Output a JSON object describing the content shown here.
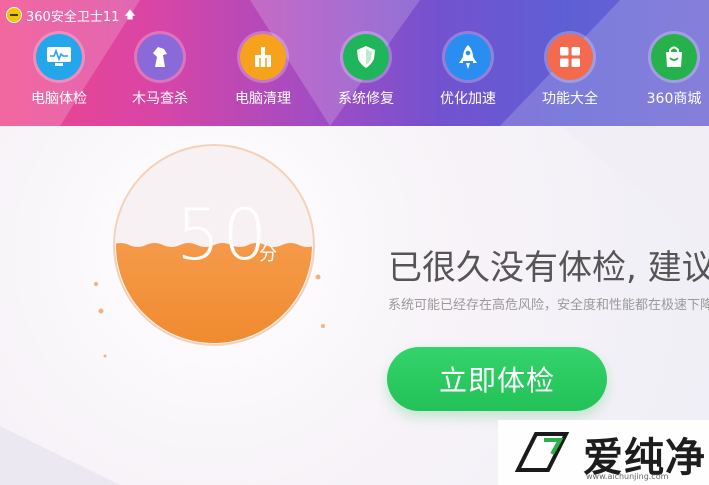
{
  "window": {
    "title": "360安全卫士11"
  },
  "nav": {
    "items": [
      {
        "label": "电脑体检",
        "icon": "monitor-icon",
        "color": "#23a6ea"
      },
      {
        "label": "木马查杀",
        "icon": "horse-icon",
        "color": "#8a6ad8"
      },
      {
        "label": "电脑清理",
        "icon": "broom-icon",
        "color": "#f6a21d"
      },
      {
        "label": "系统修复",
        "icon": "shield-icon",
        "color": "#1fb55a"
      },
      {
        "label": "优化加速",
        "icon": "rocket-icon",
        "color": "#2a8df0"
      },
      {
        "label": "功能大全",
        "icon": "grid-icon",
        "color": "#f46a4f"
      },
      {
        "label": "360商城",
        "icon": "bag-icon",
        "color": "#27b14c"
      }
    ]
  },
  "score": {
    "value": "50",
    "unit": "分",
    "level": 0.5
  },
  "status": {
    "headline": "已很久没有体检, 建议立即体检",
    "detail": "系统可能已经存在高危风险，安全度和性能都在极速下降"
  },
  "actions": {
    "check_now": "立即体检"
  },
  "watermark": {
    "brand": "爱纯净",
    "url": "www.aichunjing.com"
  }
}
